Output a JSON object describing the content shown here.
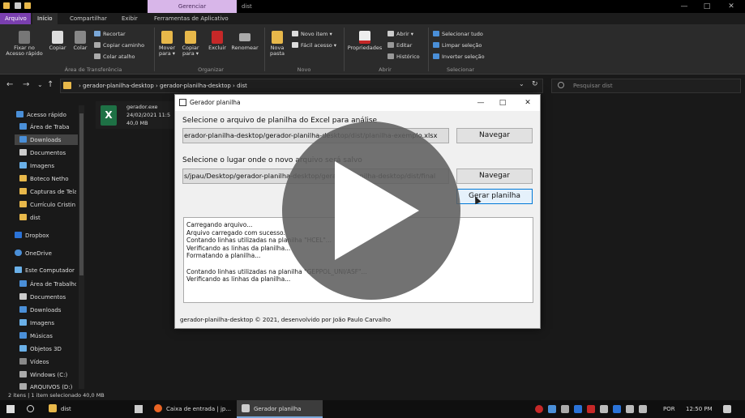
{
  "window": {
    "manage_tab": "Gerenciar",
    "title": "dist",
    "min": "—",
    "max": "□",
    "close": "✕"
  },
  "ribbon_tabs": [
    "Arquivo",
    "Início",
    "Compartilhar",
    "Exibir",
    "Ferramentas de Aplicativo"
  ],
  "ribbon": {
    "pin_line1": "Fixar no",
    "pin_line2": "Acesso rápido",
    "copy": "Copiar",
    "paste": "Colar",
    "cut": "Recortar",
    "copy_path": "Copiar caminho",
    "paste_shortcut": "Colar atalho",
    "group_clipboard": "Área de Transferência",
    "move_line1": "Mover",
    "move_line2": "para ▾",
    "copyto_line1": "Copiar",
    "copyto_line2": "para ▾",
    "delete": "Excluir",
    "rename": "Renomear",
    "group_organize": "Organizar",
    "new_folder_line1": "Nova",
    "new_folder_line2": "pasta",
    "new_item": "Novo item ▾",
    "easy_access": "Fácil acesso ▾",
    "group_new": "Novo",
    "properties": "Propriedades",
    "open": "Abrir ▾",
    "edit": "Editar",
    "history": "Histórico",
    "group_open": "Abrir",
    "select_all": "Selecionar tudo",
    "select_none": "Limpar seleção",
    "invert": "Inverter seleção",
    "group_select": "Selecionar"
  },
  "nav": {
    "back": "←",
    "forward": "→",
    "down": "⌄",
    "up": "↑",
    "path": "›  gerador-planilha-desktop  ›  gerador-planilha-desktop  ›  dist",
    "refresh": "↻",
    "search_placeholder": "Pesquisar dist",
    "dropdown": "⌄"
  },
  "sidebar": {
    "items": [
      "Acesso rápido",
      "Área de Traba",
      "Downloads",
      "Documentos",
      "Imagens",
      "Boteco Netho",
      "Capturas de Tela",
      "Currículo Cristin",
      "dist",
      "Dropbox",
      "OneDrive",
      "Este Computador",
      "Área de Trabalho",
      "Documentos",
      "Downloads",
      "Imagens",
      "Músicas",
      "Objetos 3D",
      "Vídeos",
      "Windows (C:)",
      "ARQUIVOS (D:)"
    ]
  },
  "file": {
    "name": "gerador.exe",
    "date": "24/02/2021 11:5",
    "size": "40,0 MB",
    "icon_letter": "X"
  },
  "status": {
    "text": "2 itens   |   1 item selecionado  40,0 MB"
  },
  "dialog": {
    "title": "Gerador planilha",
    "label_excel": "Selecione o arquivo de planilha do Excel para análise",
    "excel_path": "erador-planilha-desktop/gerador-planilha-desktop/dist/planilha-exemplo.xlsx",
    "navegar1": "Navegar",
    "label_save": "Selecione o lugar onde o novo arquivo será salvo",
    "save_path": "s/jpau/Desktop/gerador-planilha-desktop/gerador-planilha-desktop/dist/final",
    "navegar2": "Navegar",
    "gerar": "Gerar planilha",
    "log": [
      "Carregando arquivo...",
      "Arquivo carregado com sucesso.",
      "Contando linhas utilizadas na planilha \"HCEL\"...",
      "Verificando as linhas da planilha...",
      "Formatando a planilha...",
      "",
      "Contando linhas utilizadas na planilha \"GEPPOL_UNI/ASF\"...",
      "Verificando as linhas da planilha..."
    ],
    "footer": "gerador-planilha-desktop © 2021, desenvolvido por João Paulo Carvalho"
  },
  "taskbar": {
    "explorer": "dist",
    "browser": "Caixa de entrada | jp...",
    "app": "Gerador planilha",
    "lang": "POR",
    "time": "12:50 PM"
  },
  "colors": {
    "accent": "#7a3faf",
    "manage": "#d8b6e9",
    "excel": "#1e7145",
    "focus": "#0078d7"
  }
}
